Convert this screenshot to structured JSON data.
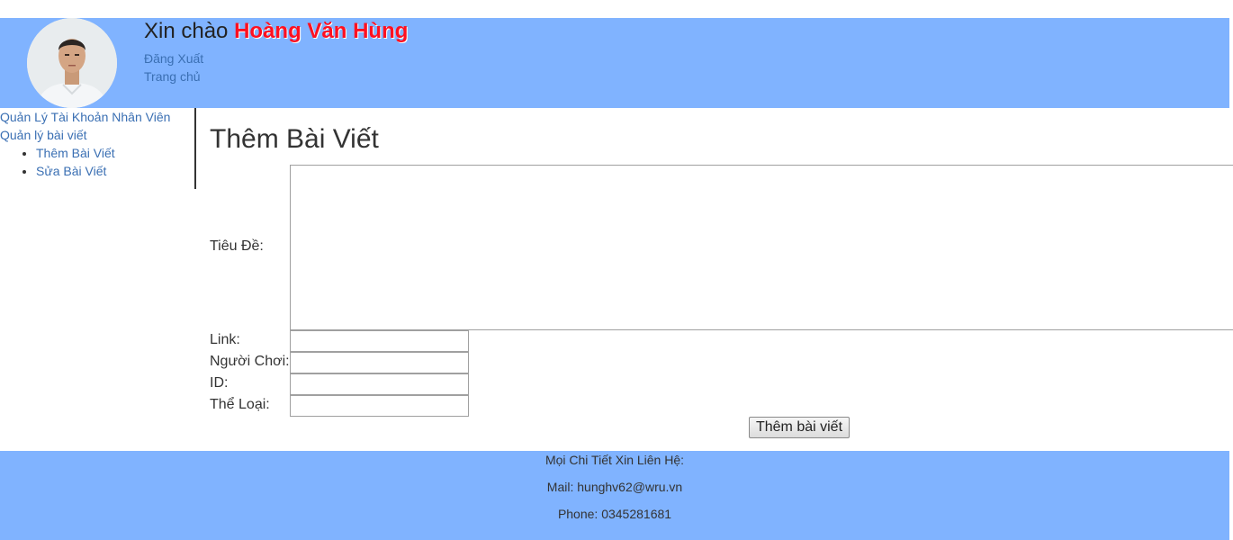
{
  "header": {
    "greeting_prefix": "Xin chào",
    "user_name": "Hoàng Văn Hùng",
    "logout_label": "Đăng Xuất",
    "home_label": "Trang chủ"
  },
  "sidebar": {
    "manage_accounts_label": "Quản Lý Tài Khoản Nhân Viên",
    "manage_posts_label": "Quản lý bài viết",
    "sub_items": [
      {
        "label": "Thêm Bài Viết"
      },
      {
        "label": "Sửa Bài Viết"
      }
    ]
  },
  "main": {
    "title": "Thêm Bài Viết",
    "form": {
      "title_label": "Tiêu Đề:",
      "title_value": "",
      "link_label": "Link:",
      "link_value": "",
      "player_label": "Người Chơi:",
      "player_value": "",
      "id_label": "ID:",
      "id_value": "",
      "category_label": "Thể Loại:",
      "category_value": "",
      "submit_label": "Thêm bài viết"
    }
  },
  "footer": {
    "contact_heading": "Mọi Chi Tiết Xin Liên Hệ:",
    "mail_line": "Mail: hunghv62@wru.vn",
    "phone_line": "Phone: 0345281681"
  },
  "colors": {
    "header_bg": "#80b3ff",
    "footer_bg": "#80b3ff",
    "user_name": "#ff1020",
    "link": "#3a6fb3"
  },
  "icons": {
    "avatar": "user-photo-avatar"
  }
}
